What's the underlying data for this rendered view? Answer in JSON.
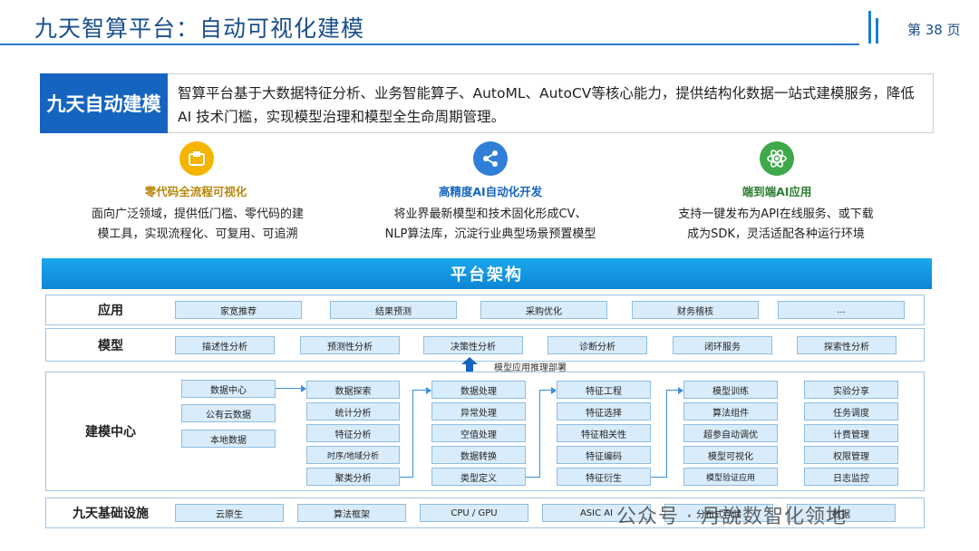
{
  "header": {
    "title": "九天智算平台：自动可视化建模",
    "page_label": "第 38 页"
  },
  "intro": {
    "label": "九天自动建模",
    "text": "智算平台基于大数据特征分析、业务智能算子、AutoML、AutoCV等核心能力，提供结构化数据一站式建模服务，降低 AI 技术门槛，实现模型治理和模型全生命周期管理。"
  },
  "features": [
    {
      "icon": "box-icon",
      "color": "#f5b400",
      "title": "零代码全流程可视化",
      "lines": [
        "面向广泛领域，提供低门槛、零代码的建",
        "模工具，实现流程化、可复用、可追溯"
      ]
    },
    {
      "icon": "share-nodes-icon",
      "color": "#2f7fd8",
      "title": "高精度AI自动化开发",
      "lines": [
        "将业界最新模型和技术固化形成CV、",
        "NLP算法库，沉淀行业典型场景预置模型"
      ]
    },
    {
      "icon": "atom-icon",
      "color": "#3fa84a",
      "title": "端到端AI应用",
      "lines": [
        "支持一键发布为API在线服务、或下载",
        "成为SDK，灵活适配各种运行环境"
      ]
    }
  ],
  "architecture": {
    "title": "平台架构",
    "rows": {
      "app": {
        "label": "应用",
        "items": [
          "家宽推荐",
          "结果预测",
          "采购优化",
          "财务稽核",
          "..."
        ]
      },
      "model": {
        "label": "模型",
        "items": [
          "描述性分析",
          "预测性分析",
          "决策性分析",
          "诊断分析",
          "闭环服务",
          "探索性分析"
        ]
      },
      "modeling": {
        "label": "建模中心",
        "deploy_label": "模型应用推理部署",
        "columns": [
          [
            "数据中心",
            "公有云数据",
            "本地数据"
          ],
          [
            "数据探索",
            "统计分析",
            "特征分析",
            "时序/地域分析",
            "聚类分析"
          ],
          [
            "数据处理",
            "异常处理",
            "空值处理",
            "数据转换",
            "类型定义"
          ],
          [
            "特征工程",
            "特征选择",
            "特征相关性",
            "特征编码",
            "特征衍生"
          ],
          [
            "模型训练",
            "算法组件",
            "超参自动调优",
            "模型可视化",
            "模型验证应用"
          ],
          [
            "实验分享",
            "任务调度",
            "计费管理",
            "权限管理",
            "日志监控"
          ]
        ]
      },
      "infra": {
        "label": "九天基础设施",
        "items": [
          "云原生",
          "算法框架",
          "CPU / GPU",
          "ASIC AI",
          "分布式存储",
          "数据"
        ]
      }
    }
  },
  "watermark": "公众号 · 月說数智化领地",
  "colors": {
    "brand_blue": "#1565c0",
    "header_blue": "#1aa7ec",
    "cell_fill": "#d9ecfb"
  }
}
